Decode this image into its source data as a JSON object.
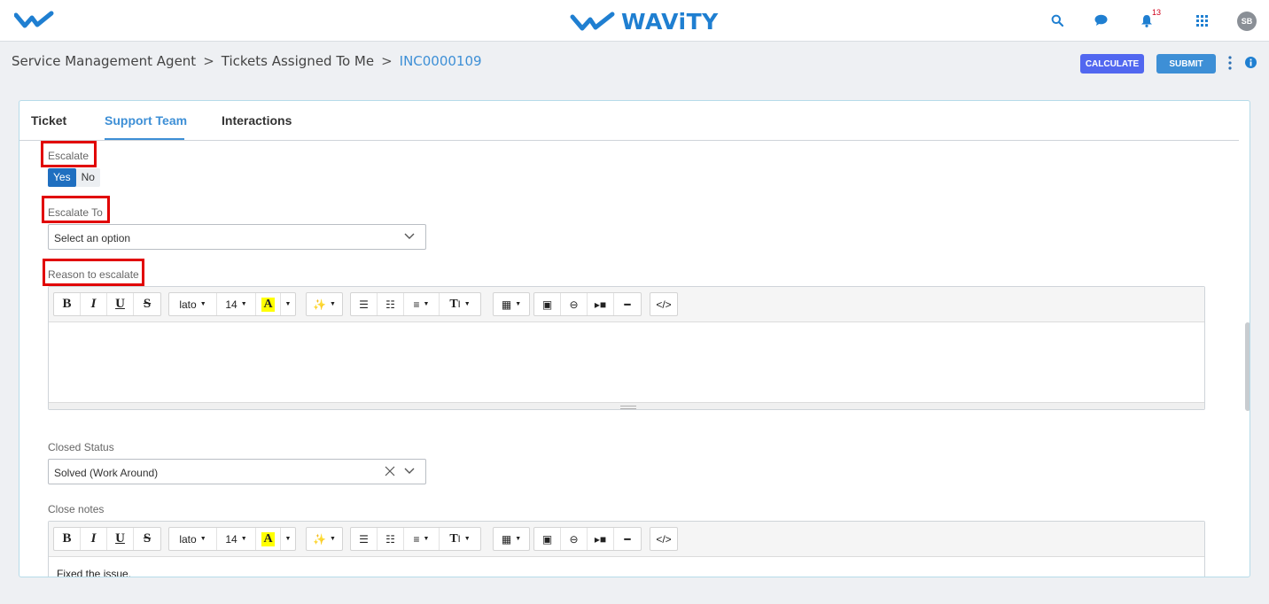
{
  "header": {
    "brand_name": "WAViTY",
    "notifications_count": "13",
    "avatar_initials": "SB",
    "icons": [
      "wavity-logo-icon",
      "search-icon",
      "chat-icon",
      "bell-icon",
      "apps-grid-icon"
    ],
    "brand_color": "#1f7fd1"
  },
  "breadcrumb": {
    "items": [
      "Service Management Agent",
      "Tickets Assigned To Me"
    ],
    "separator": ">",
    "current": "INC0000109"
  },
  "actions": {
    "calculate_label": "CALCULATE",
    "submit_label": "SUBMIT"
  },
  "tabs": [
    {
      "label": "Ticket",
      "active": false
    },
    {
      "label": "Support Team",
      "active": true
    },
    {
      "label": "Interactions",
      "active": false
    }
  ],
  "form": {
    "escalate": {
      "label": "Escalate",
      "yes": "Yes",
      "no": "No",
      "selected": "Yes"
    },
    "escalate_to": {
      "label": "Escalate To",
      "value": "Select an option"
    },
    "reason": {
      "label": "Reason to escalate",
      "value": ""
    },
    "closed_status": {
      "label": "Closed Status",
      "value": "Solved (Work Around)"
    },
    "close_notes": {
      "label": "Close notes",
      "value": "Fixed the issue."
    }
  },
  "editor_toolbar": {
    "bold": "B",
    "italic": "I",
    "underline": "U",
    "strike": "S",
    "font_name": "lato",
    "font_size": "14",
    "highlight": "A",
    "code": "</>",
    "text_style": "T"
  }
}
